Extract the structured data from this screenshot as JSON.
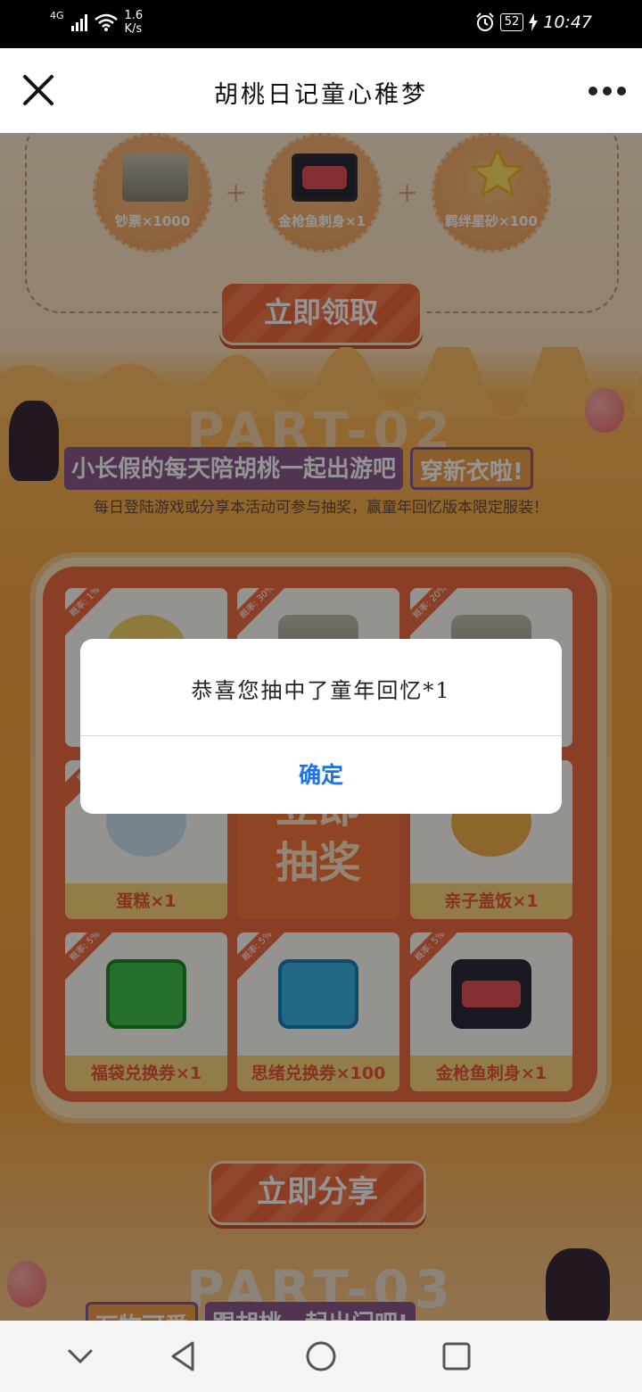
{
  "status_bar": {
    "network": "4G",
    "speed_value": "1.6",
    "speed_unit": "K/s",
    "battery": "52",
    "time": "10:47"
  },
  "title_bar": {
    "title": "胡桃日记童心稚梦",
    "close_icon": "close-icon",
    "more_icon": "more-dots-icon"
  },
  "rewards": {
    "items": [
      {
        "label": "钞票×1000",
        "icon": "banknote-stack-icon"
      },
      {
        "label": "金枪鱼刺身×1",
        "icon": "tuna-sashimi-icon"
      },
      {
        "label": "羁绊星砂×100",
        "icon": "star-icon"
      }
    ],
    "claim_button": "立即领取"
  },
  "part2": {
    "part_label": "PART-02",
    "banner_main": "小长假的每天陪胡桃一起出游吧",
    "banner_highlight": "穿新衣啦!",
    "subtitle": "每日登陆游戏或分享本活动可参与抽奖，赢童年回忆版本限定服装！",
    "prizes": [
      {
        "rate": "概率: 1%",
        "label": ""
      },
      {
        "rate": "概率: 30%",
        "label": ""
      },
      {
        "rate": "概率: 20%",
        "label": ""
      },
      {
        "rate": "概率",
        "label": "蛋糕×1"
      },
      {
        "rate": "概率",
        "label": "亲子盖饭×1"
      },
      {
        "rate": "概率: 5%",
        "label": "福袋兑换券×1"
      },
      {
        "rate": "概率: 5%",
        "label": "思绪兑换券×100"
      },
      {
        "rate": "概率: 5%",
        "label": "金枪鱼刺身×1"
      }
    ],
    "draw_button_line1": "立即",
    "draw_button_line2": "抽奖",
    "share_button": "立即分享"
  },
  "part3": {
    "part_label": "PART-03",
    "banner_highlight": "万物可爱",
    "banner_main": "跟胡桃一起出门吧!"
  },
  "dialog": {
    "message": "恭喜您抽中了童年回忆*1",
    "confirm_label": "确定"
  },
  "nav_bar": {
    "buttons": [
      "chevron-down-icon",
      "back-triangle-icon",
      "home-circle-icon",
      "recents-square-icon"
    ]
  },
  "colors": {
    "accent_orange": "#f06c43",
    "dialog_button_blue": "#1a73e8",
    "banner_purple": "#8a5a8e"
  }
}
